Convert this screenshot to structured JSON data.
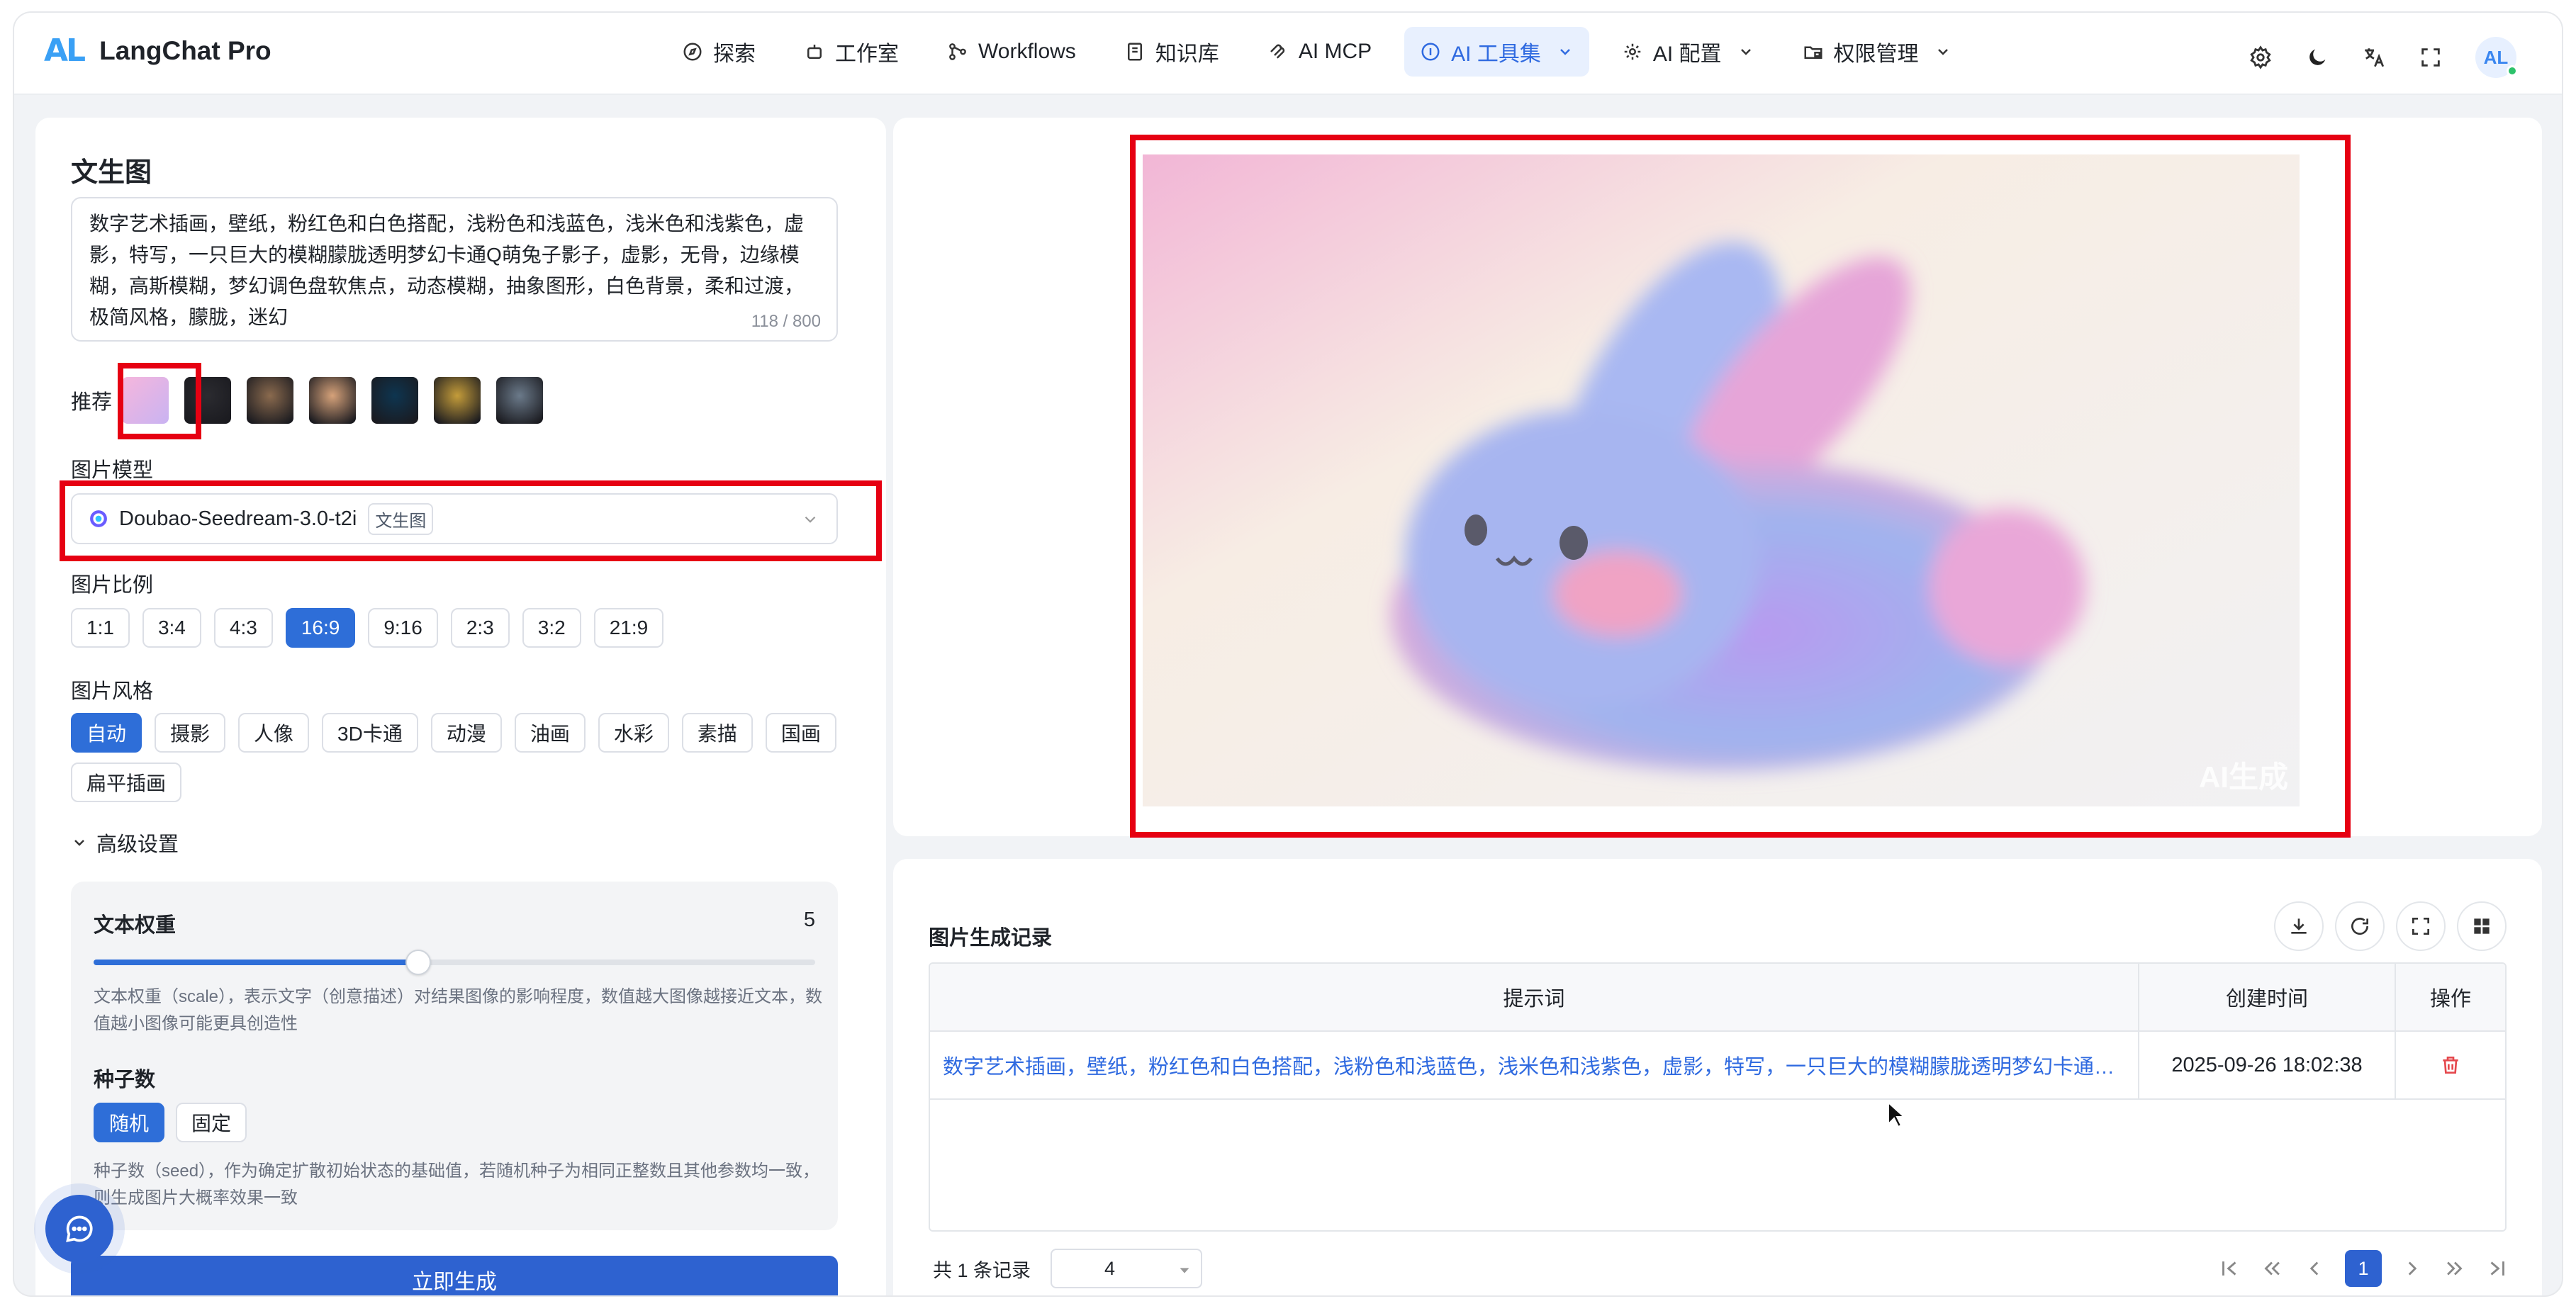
{
  "app": {
    "logo_mark": "AL",
    "name": "LangChat Pro"
  },
  "nav": [
    {
      "label": "探索",
      "icon": "compass-icon"
    },
    {
      "label": "工作室",
      "icon": "robot-icon"
    },
    {
      "label": "Workflows",
      "icon": "workflow-icon"
    },
    {
      "label": "知识库",
      "icon": "book-icon"
    },
    {
      "label": "AI MCP",
      "icon": "mcp-icon"
    },
    {
      "label": "AI 工具集",
      "icon": "tool-icon",
      "active": true
    },
    {
      "label": "AI 配置",
      "icon": "gear-icon"
    },
    {
      "label": "权限管理",
      "icon": "folder-lock-icon"
    }
  ],
  "header_actions": [
    "settings-icon",
    "moon-icon",
    "translate-icon",
    "fullscreen-icon"
  ],
  "avatar": {
    "text": "AL"
  },
  "left": {
    "title": "文生图",
    "prompt": {
      "value": "数字艺术插画，壁纸，粉红色和白色搭配，浅粉色和浅蓝色，浅米色和浅紫色，虚影，特写，一只巨大的模糊朦胧透明梦幻卡通Q萌兔子影子，虚影，无骨，边缘模糊，高斯模糊，梦幻调色盘软焦点，动态模糊，抽象图形，白色背景，柔和过渡，极简风格，朦胧，迷幻",
      "count": "118 / 800"
    },
    "recommend_label": "推荐",
    "thumb_colors": [
      "#f2a7d6",
      "#2b2b30",
      "#8a6a4e",
      "#d6a27a",
      "#0e3550",
      "#c49c3a",
      "#6b7a8a"
    ],
    "model_label": "图片模型",
    "model": {
      "name": "Doubao-Seedream-3.0-t2i",
      "tag": "文生图"
    },
    "ratio_label": "图片比例",
    "ratios": [
      "1:1",
      "3:4",
      "4:3",
      "16:9",
      "9:16",
      "2:3",
      "3:2",
      "21:9"
    ],
    "ratio_selected": "16:9",
    "style_label": "图片风格",
    "styles": [
      "自动",
      "摄影",
      "人像",
      "3D卡通",
      "动漫",
      "油画",
      "水彩",
      "素描",
      "国画",
      "扁平插画"
    ],
    "style_selected": "自动",
    "advanced_label": "高级设置",
    "text_weight": {
      "label": "文本权重",
      "value": "5",
      "fraction": 0.45,
      "desc": "文本权重（scale），表示文字（创意描述）对结果图像的影响程度，数值越大图像越接近文本，数值越小图像可能更具创造性"
    },
    "seed": {
      "label": "种子数",
      "options": [
        "随机",
        "固定"
      ],
      "selected": "随机",
      "desc": "种子数（seed），作为确定扩散初始状态的基础值，若随机种子为相同正整数且其他参数均一致，则生成图片大概率效果一致"
    },
    "generate_label": "立即生成"
  },
  "preview": {
    "watermark": "AI生成"
  },
  "history": {
    "title": "图片生成记录",
    "columns": [
      "提示词",
      "创建时间",
      "操作"
    ],
    "rows": [
      {
        "prompt": "数字艺术插画，壁纸，粉红色和白色搭配，浅粉色和浅蓝色，浅米色和浅紫色，虚影，特写，一只巨大的模糊朦胧透明梦幻卡通Q萌...",
        "time": "2025-09-26 18:02:38"
      }
    ],
    "total": "共 1 条记录",
    "page_size": "4",
    "current_page": "1"
  },
  "colors": {
    "primary": "#2e62d0",
    "highlight": "#e60012",
    "link": "#2f6ae0"
  }
}
